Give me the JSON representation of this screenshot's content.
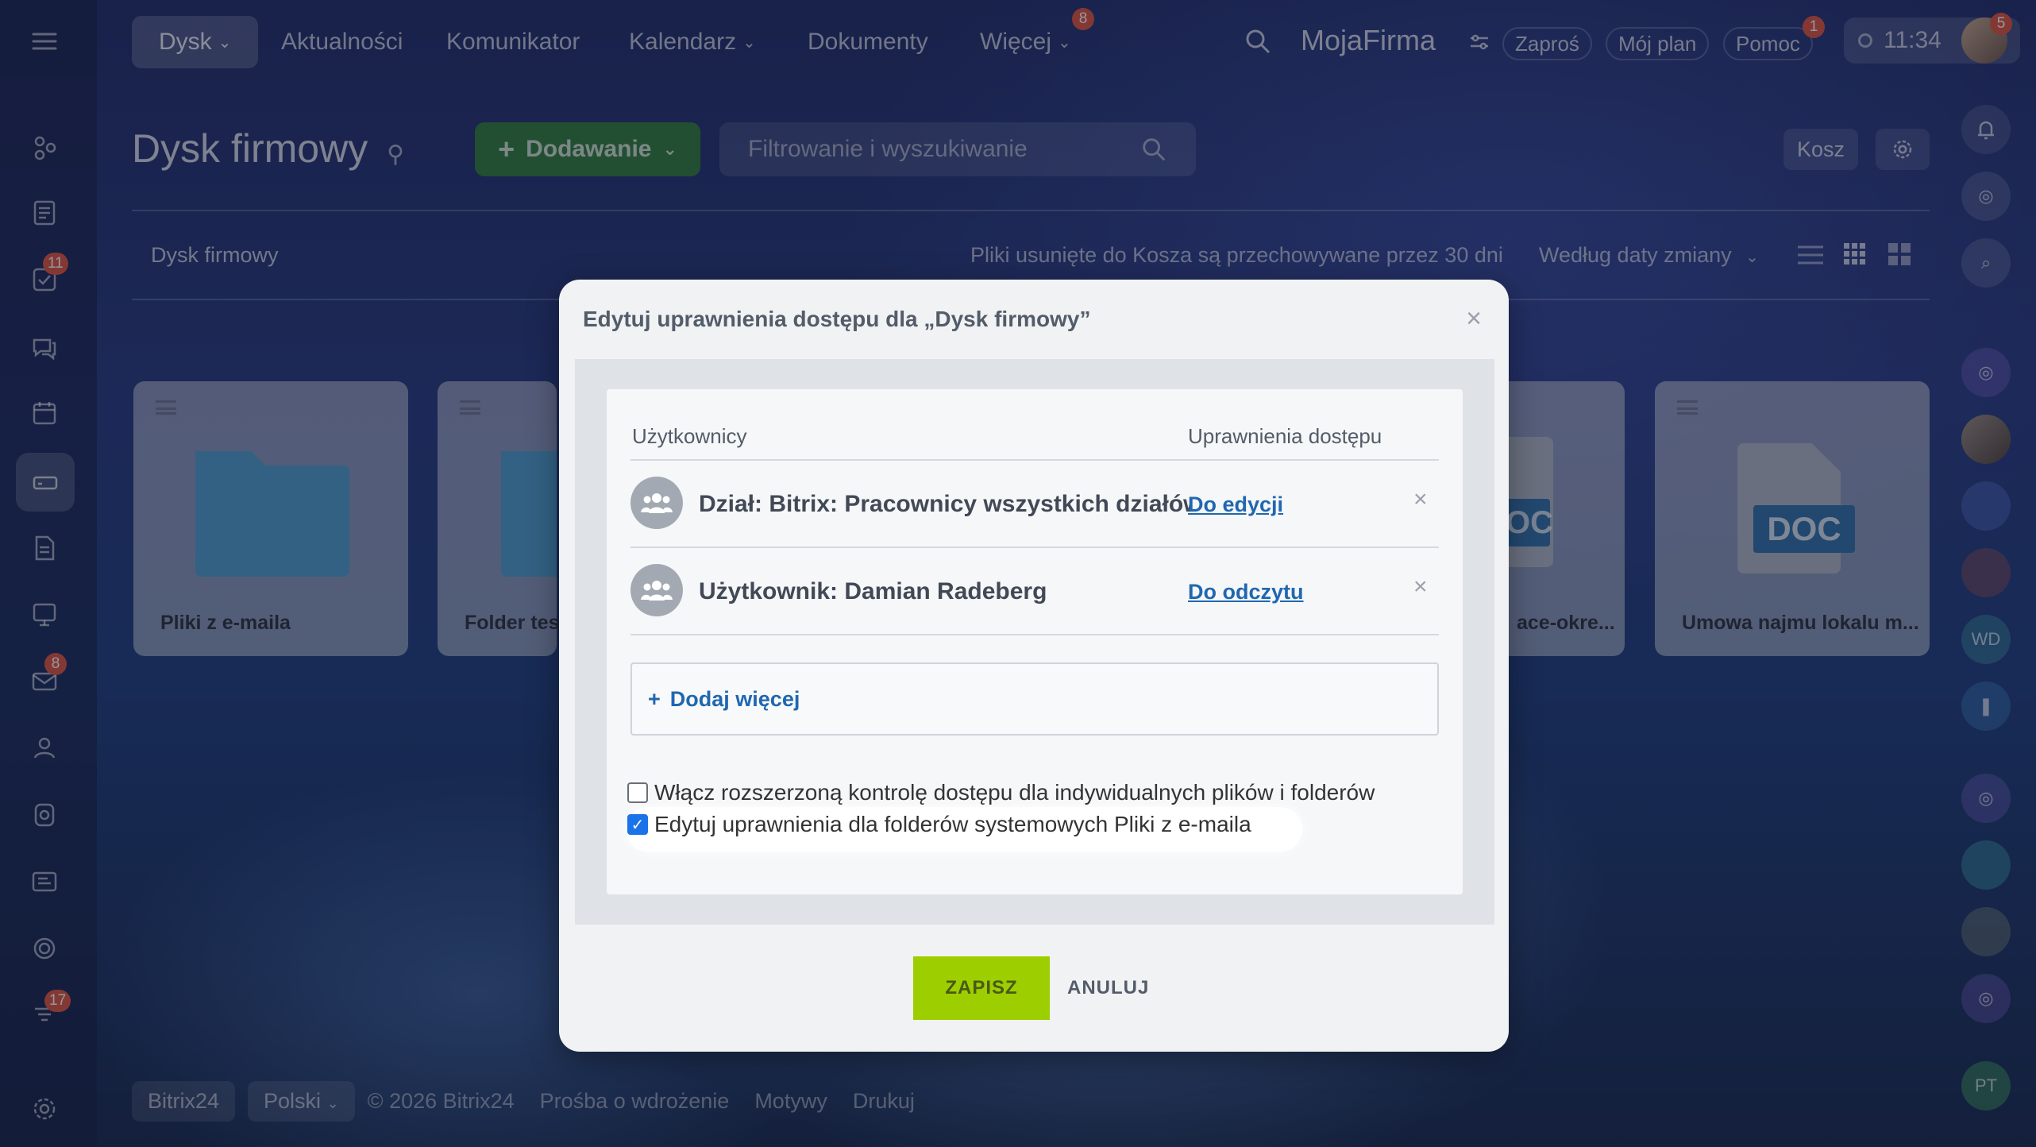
{
  "topbar": {
    "active_tab": "Dysk",
    "nav": [
      "Aktualności",
      "Komunikator",
      "Kalendarz",
      "Dokumenty",
      "Więcej"
    ],
    "more_badge": "8",
    "company": "MojaFirma",
    "invite": "Zaproś",
    "my_plan": "Mój plan",
    "help": "Pomoc",
    "help_badge": "1",
    "time": "11:34",
    "avatar_badge": "5"
  },
  "sidebar": {
    "badges": {
      "tasks": "11",
      "mail": "8",
      "feed": "17"
    }
  },
  "header": {
    "title": "Dysk firmowy",
    "add_label": "Dodawanie",
    "search_placeholder": "Filtrowanie i wyszukiwanie",
    "trash_label": "Kosz",
    "breadcrumb": "Dysk firmowy",
    "trash_note": "Pliki usunięte do Kosza są przechowywane przez 30 dni",
    "sort_label": "Według daty zmiany"
  },
  "files": [
    {
      "name": "Pliki z e-maila",
      "type": "folder"
    },
    {
      "name": "Folder tes",
      "type": "folder"
    },
    {
      "name": "ace-okre...",
      "type": "doc"
    },
    {
      "name": "Umowa najmu lokalu m...",
      "type": "doc"
    }
  ],
  "doc_label": "DOC",
  "doc_label_partial": "OC",
  "right_rail": {
    "wd": "WD",
    "pt": "PT"
  },
  "footer": {
    "brand": "Bitrix24",
    "lang": "Polski",
    "copyright": "© 2026 Bitrix24",
    "links": [
      "Prośba o wdrożenie",
      "Motywy",
      "Drukuj"
    ]
  },
  "modal": {
    "title": "Edytuj uprawnienia dostępu dla „Dysk firmowy”",
    "col_users": "Użytkownicy",
    "col_perms": "Uprawnienia dostępu",
    "rows": [
      {
        "name": "Dział: Bitrix: Pracownicy wszystkich działów",
        "perm": "Do edycji"
      },
      {
        "name": "Użytkownik: Damian Radeberg",
        "perm": "Do odczytu"
      }
    ],
    "add_more": "Dodaj więcej",
    "checkbox1": {
      "label": "Włącz rozszerzoną kontrolę dostępu dla indywidualnych plików i folderów",
      "checked": false
    },
    "checkbox2": {
      "label": "Edytuj uprawnienia dla folderów systemowych Pliki z e-maila",
      "checked": true
    },
    "save": "ZAPISZ",
    "cancel": "ANULUJ"
  }
}
